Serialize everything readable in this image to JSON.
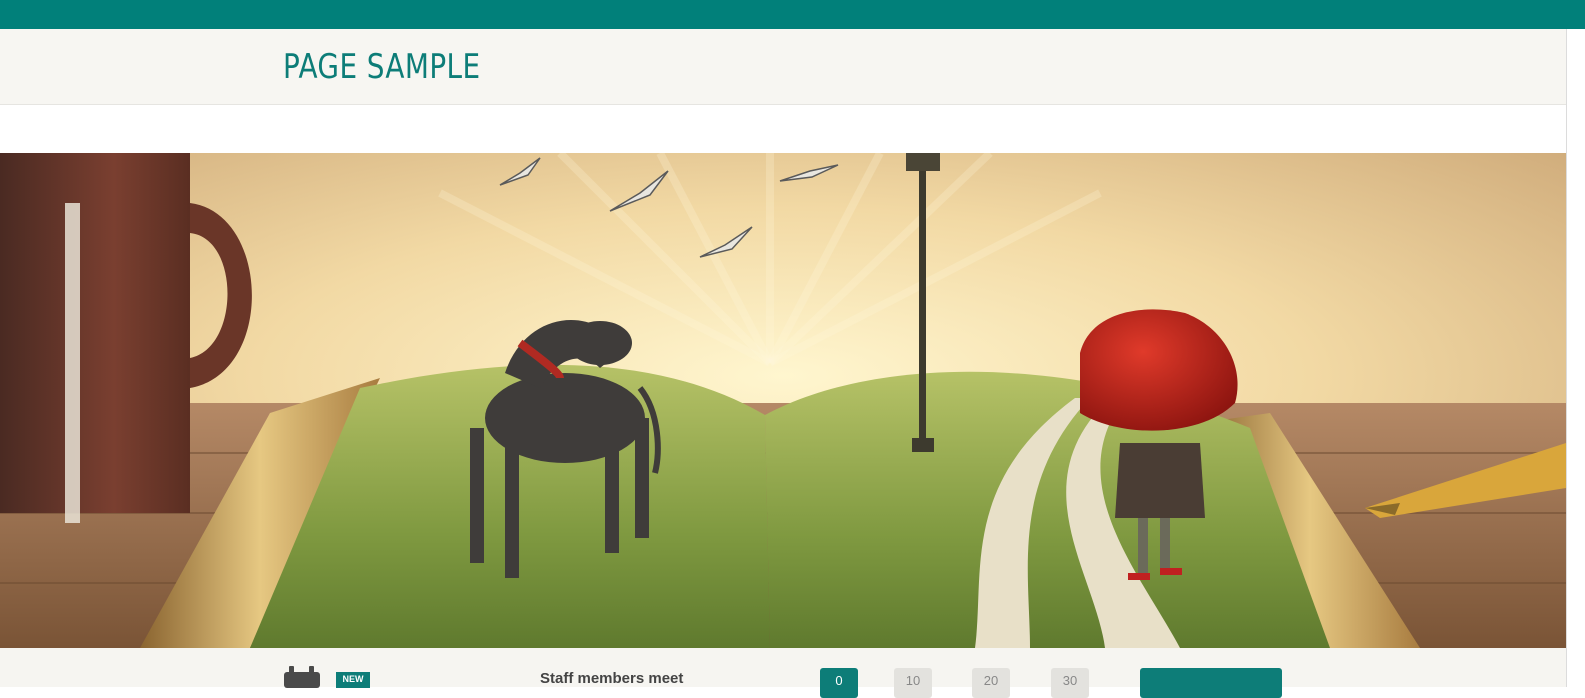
{
  "header": {
    "title": "PAGE SAMPLE"
  },
  "hero": {
    "image_alt": "Open book with grass landscape, dog, girl with red umbrella, lamp post, birds, mug and fountain pen"
  },
  "footer": {
    "badge_text": "NEW",
    "staff_text": "Staff members meet",
    "counters": [
      "0",
      "10",
      "20",
      "30"
    ],
    "button_label": ""
  },
  "colors": {
    "brand": "#01807a",
    "header_bg": "#f7f6f2",
    "title": "#0d7d78"
  },
  "icons": [
    "calendar-icon"
  ]
}
